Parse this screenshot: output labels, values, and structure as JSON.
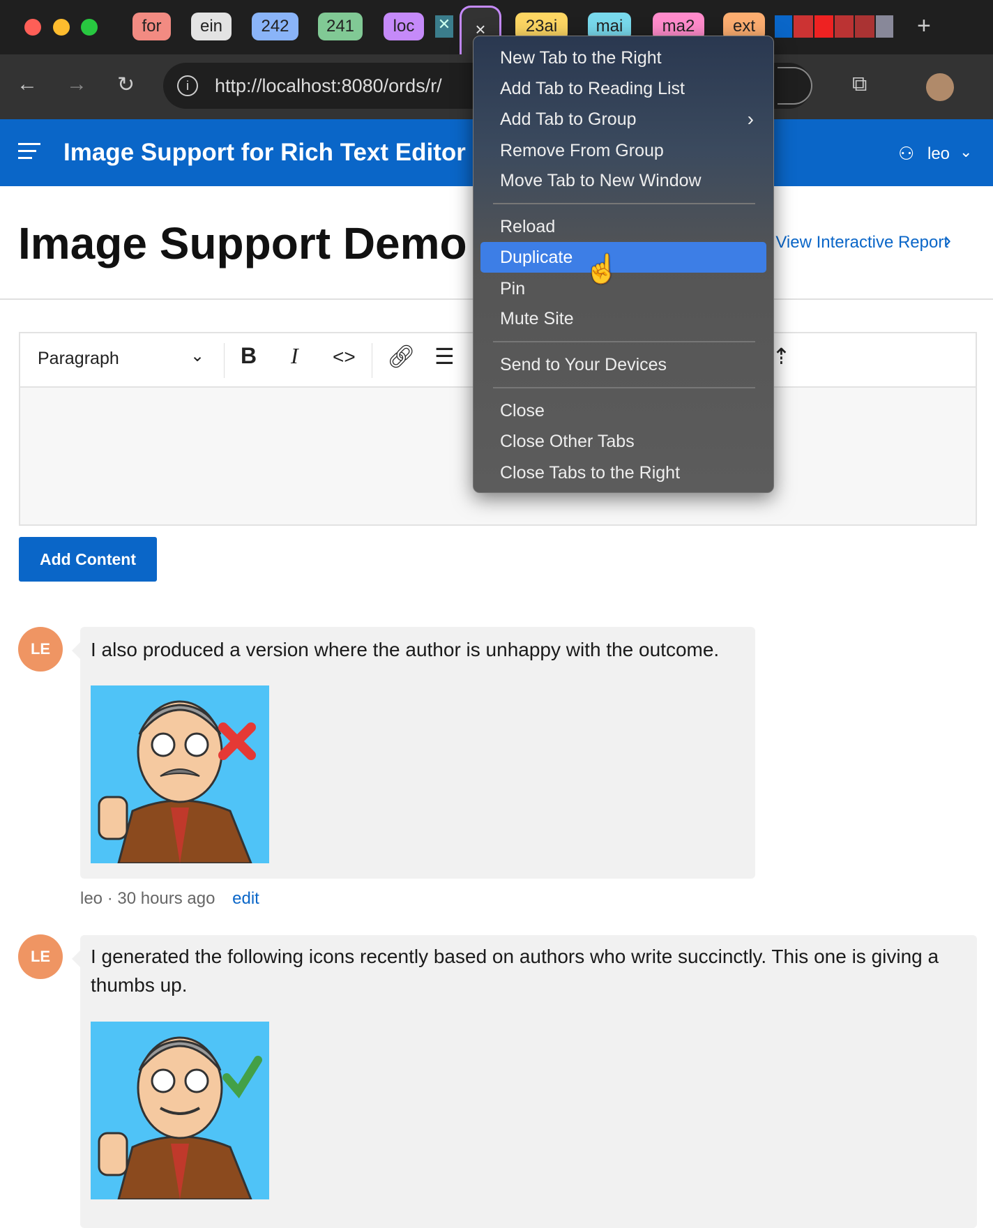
{
  "browser": {
    "tabs": [
      {
        "label": "for",
        "color": "#f28b82"
      },
      {
        "label": "ein",
        "color": "#e3e3e3"
      },
      {
        "label": "242",
        "color": "#8ab4f8"
      },
      {
        "label": "241",
        "color": "#81c995"
      },
      {
        "label": "loc",
        "color": "#c58af9"
      },
      {
        "label": "23ai",
        "color": "#fdd663"
      },
      {
        "label": "mai",
        "color": "#78d9ec"
      },
      {
        "label": "ma2",
        "color": "#ff8bcb"
      },
      {
        "label": "ext",
        "color": "#fcad70"
      }
    ],
    "active_tab_close": "×",
    "new_tab": "+",
    "url": "http://localhost:8080/ords/r/"
  },
  "header": {
    "title": "Image Support for Rich Text Editor",
    "user": "leo"
  },
  "page": {
    "title": "Image Support Demo",
    "report_link": "View Interactive Report"
  },
  "editor": {
    "format": "Paragraph",
    "bold": "B",
    "italic": "I",
    "code": "<>"
  },
  "add_button": "Add Content",
  "comments": [
    {
      "initials": "LE",
      "text": "I also produced a version where the author is unhappy with the outcome.",
      "author": "leo",
      "time": "30 hours ago",
      "edit": "edit",
      "mood": "thumbs-down"
    },
    {
      "initials": "LE",
      "text": "I generated the following icons recently based on authors who write succinctly. This one is giving a thumbs up.",
      "mood": "thumbs-up"
    }
  ],
  "context_menu": {
    "items": [
      "New Tab to the Right",
      "Add Tab to Reading List",
      "Add Tab to Group",
      "Remove From Group",
      "Move Tab to New Window",
      "Reload",
      "Duplicate",
      "Pin",
      "Mute Site",
      "Send to Your Devices",
      "Close",
      "Close Other Tabs",
      "Close Tabs to the Right"
    ],
    "highlighted": "Duplicate"
  }
}
